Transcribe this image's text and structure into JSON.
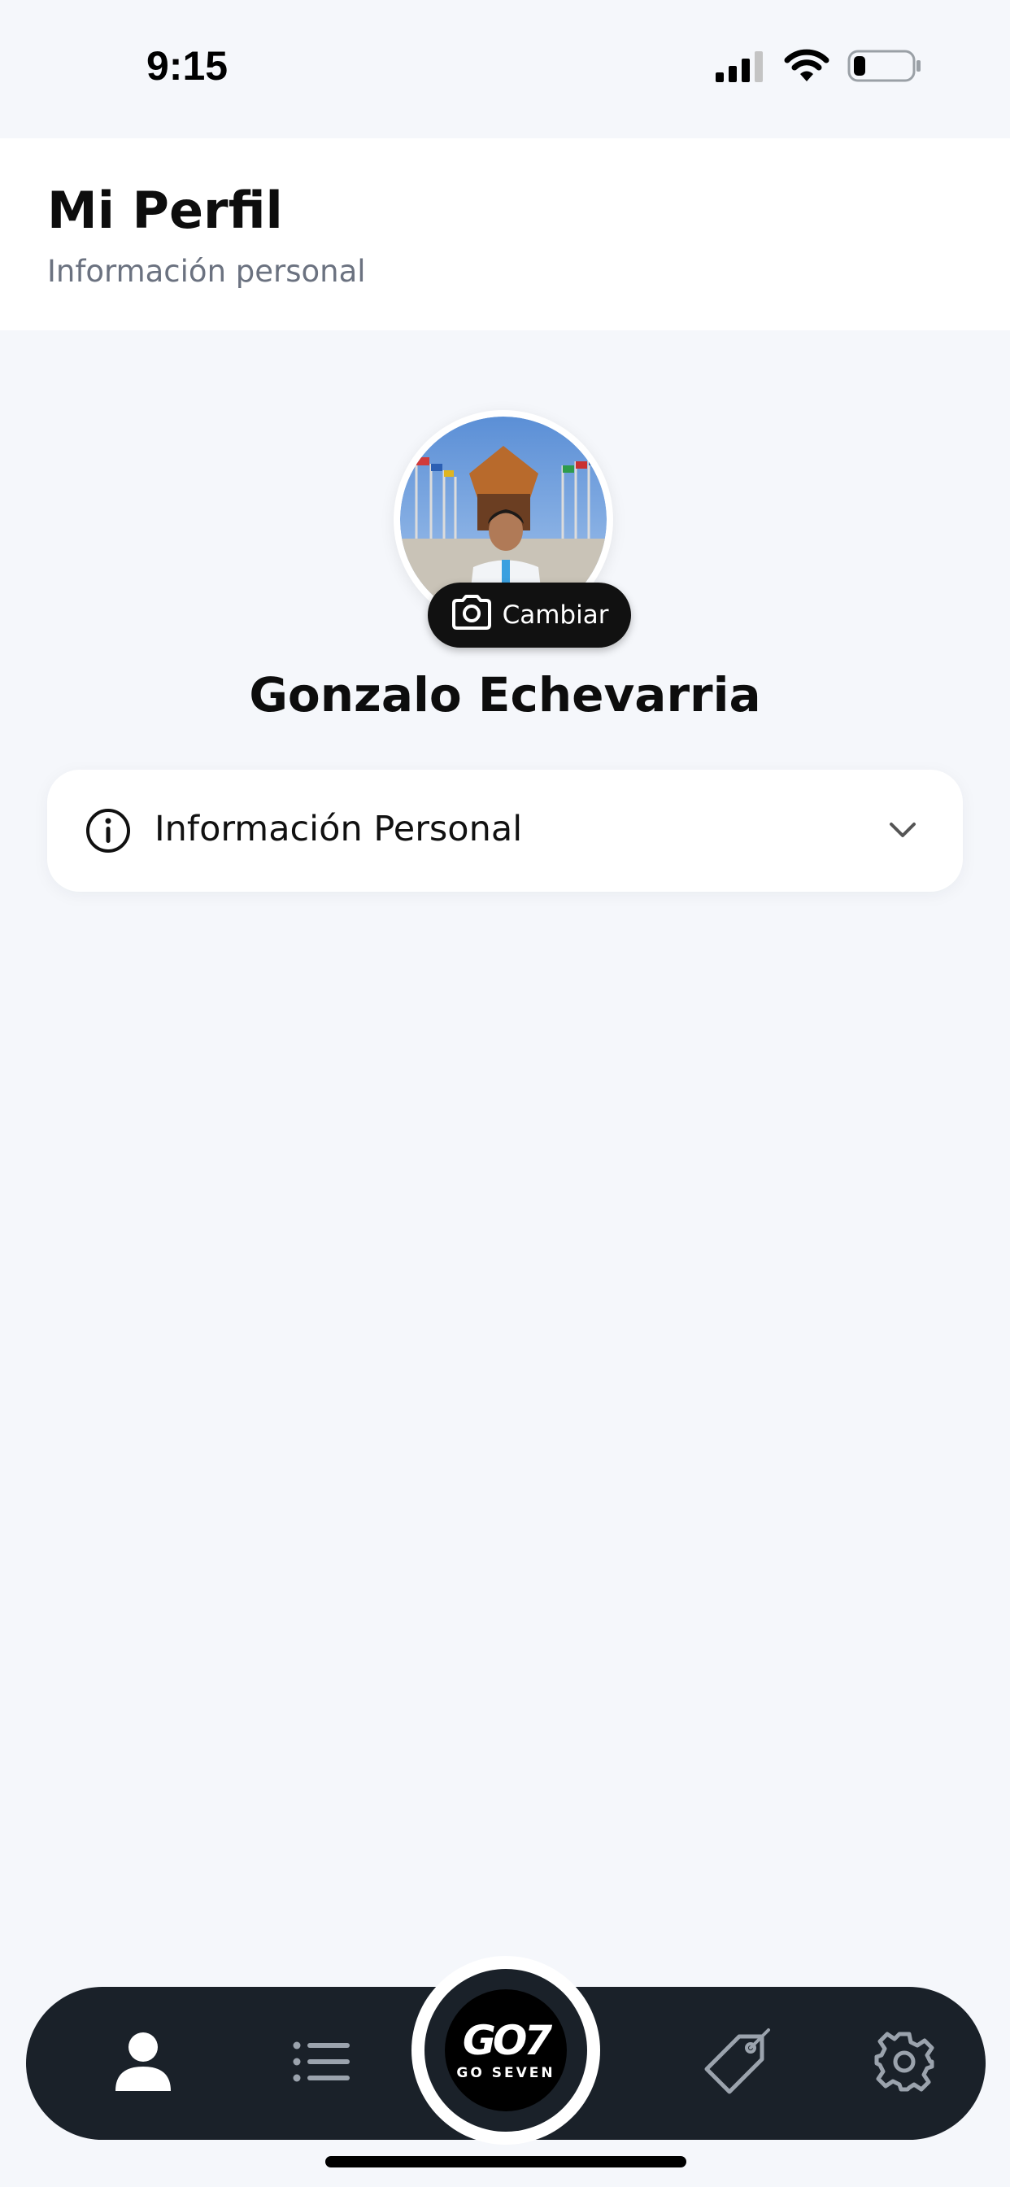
{
  "status_bar": {
    "time": "9:15",
    "icons": [
      "signal-icon",
      "wifi-icon",
      "battery-icon"
    ]
  },
  "header": {
    "title": "Mi Perfil",
    "subtitle": "Información personal"
  },
  "profile": {
    "change_photo_label": "Cambiar",
    "name": "Gonzalo Echevarria"
  },
  "sections": [
    {
      "label": "Información Personal",
      "icon": "info-icon",
      "expanded": false
    }
  ],
  "bottom_nav": {
    "items": [
      {
        "icon": "user-icon",
        "active": true
      },
      {
        "icon": "list-icon",
        "active": false
      },
      {
        "icon": "go-seven-logo",
        "active": false
      },
      {
        "icon": "tag-icon",
        "active": false
      },
      {
        "icon": "gear-icon",
        "active": false
      }
    ],
    "logo_text": "GO7",
    "logo_subtext": "GO SEVEN"
  },
  "colors": {
    "background": "#f5f7fb",
    "nav_background": "#1a2129",
    "card": "#ffffff",
    "subtitle": "#6b7280"
  }
}
